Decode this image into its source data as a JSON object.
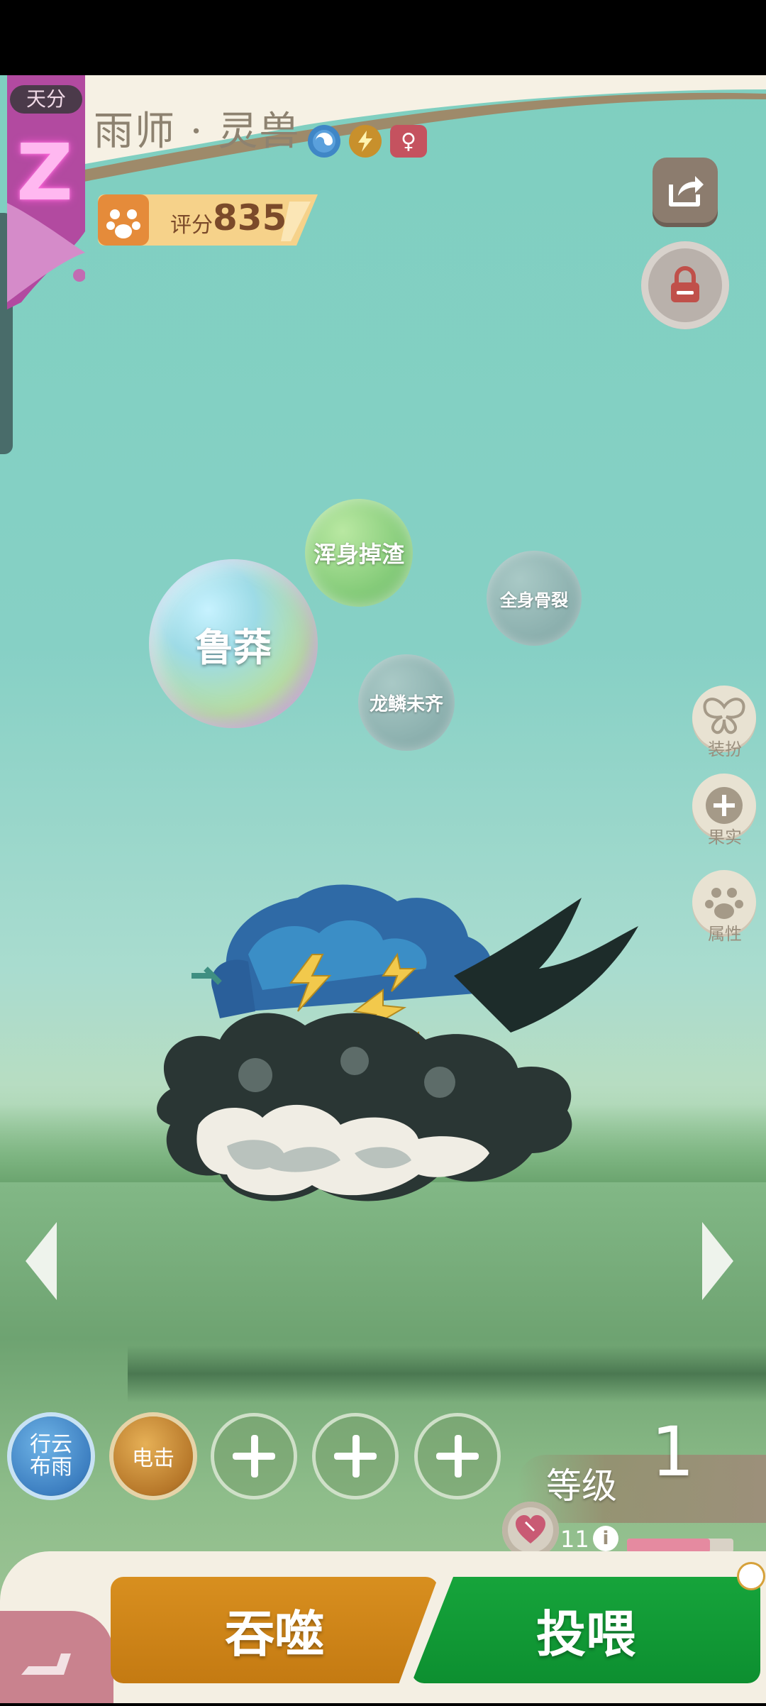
{
  "header": {
    "rank_label": "天分",
    "rank_letter": "Z",
    "pet_title": "雨师 · 灵兽",
    "score_label": "评分",
    "score_value": "835",
    "type_icons": [
      "swirl-icon",
      "lightning-icon",
      "female-icon"
    ]
  },
  "bubbles": {
    "main": "鲁莽",
    "green": "浑身掉渣",
    "grey_right": "全身骨裂",
    "grey_bottom": "龙鳞未齐"
  },
  "side_menu": [
    {
      "label": "装扮",
      "icon": "butterfly-icon"
    },
    {
      "label": "果实",
      "icon": "plus-icon"
    },
    {
      "label": "属性",
      "icon": "paw-icon"
    }
  ],
  "skills": [
    {
      "label": "行云\n布雨",
      "icon": "cloud-rain-skill-icon"
    },
    {
      "label": "电击",
      "icon": "shock-skill-icon"
    },
    {
      "label": "",
      "icon": "plus-icon"
    },
    {
      "label": "",
      "icon": "plus-icon"
    },
    {
      "label": "",
      "icon": "plus-icon"
    }
  ],
  "level": {
    "label": "等级",
    "value": "1",
    "hearts": "11",
    "hp_fraction": 0.78
  },
  "actions": {
    "devour_label": "吞噬",
    "feed_label": "投喂"
  },
  "colors": {
    "accent_orange": "#c47a12",
    "accent_green": "#0d8f30",
    "rank_glow": "#ff5ad8",
    "sky": "#7fcfc0"
  }
}
